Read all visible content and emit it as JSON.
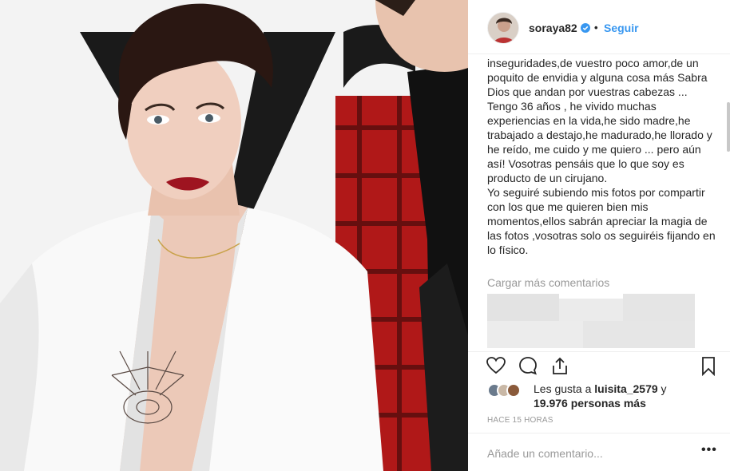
{
  "post": {
    "username": "soraya82",
    "follow_label": "Seguir",
    "separator": "•",
    "caption_lines": [
      "inseguridades,de vuestro poco amor,de un poquito de envidia y alguna cosa más Sabra Dios que andan por vuestras cabezas ...",
      "Tengo 36 años , he vivido muchas experiencias en la vida,he sido madre,he trabajado a destajo,he madurado,he llorado y he reído, me cuido y me quiero ... pero aún así! Vosotras pensáis que lo que soy es producto de un cirujano.",
      "Yo seguiré subiendo mis fotos por compartir con los que me quieren bien mis momentos,ellos sabrán apreciar la magia de las fotos ,vosotras solo os seguiréis fijando en lo físico."
    ],
    "load_more_label": "Cargar más comentarios",
    "likes": {
      "prefix": "Les gusta a ",
      "user": "luisita_2579",
      "middle": " y",
      "count": "19.976 personas más"
    },
    "timestamp": "HACE 15 HORAS",
    "comment_placeholder": "Añade un comentario...",
    "more_label": "•••"
  },
  "icons": {
    "verified": "verified-badge-icon",
    "like": "heart-icon",
    "comment": "comment-bubble-icon",
    "share": "share-icon",
    "save": "bookmark-icon"
  },
  "colors": {
    "link_blue": "#3897f0",
    "verified_blue": "#3897f0",
    "muted_text": "#999999"
  }
}
